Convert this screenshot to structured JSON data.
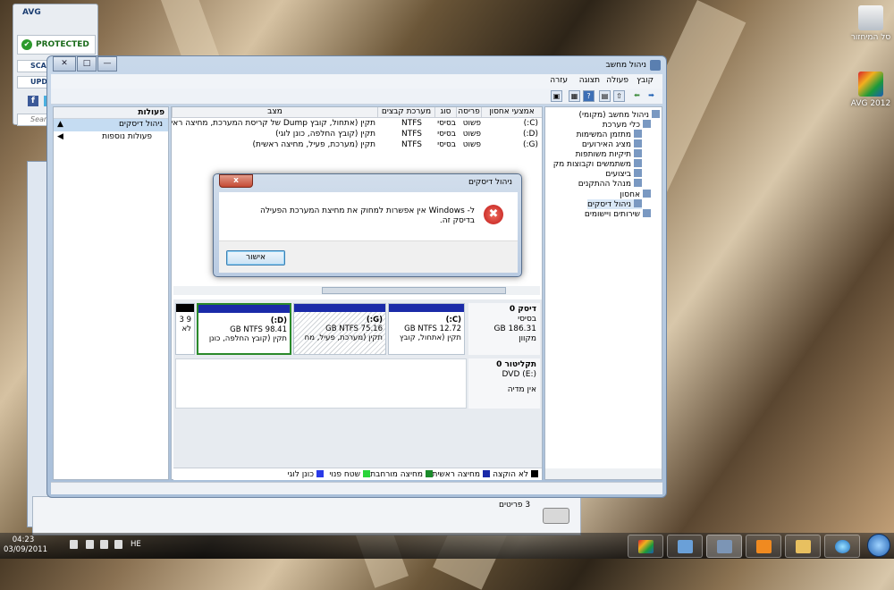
{
  "desktop": {
    "icons": [
      {
        "label": "סל המיחזור",
        "icon": "recycle-bin-icon"
      },
      {
        "label": "AVG 2012",
        "icon": "avg-icon"
      }
    ]
  },
  "avg_widget": {
    "logo": "AVG",
    "status": "PROTECTED",
    "scan_label": "SCA",
    "update_label": "UPDA",
    "facebook": "f",
    "search_placeholder": "Search"
  },
  "window": {
    "title": "ניהול מחשב",
    "buttons": {
      "close": "✕",
      "maximize": "□",
      "minimize": "—"
    },
    "menu": [
      "קובץ",
      "פעולה",
      "תצוגה",
      "עזרה"
    ],
    "toolbar_icons": [
      "back-icon",
      "forward-icon",
      "up-icon",
      "show-hide-tree-icon",
      "help-icon",
      "properties-icon",
      "export-icon"
    ]
  },
  "tree": {
    "items": [
      {
        "label": "ניהול מחשב (מקומי)",
        "level": 0
      },
      {
        "label": "כלי מערכת",
        "level": 1
      },
      {
        "label": "מתזמן המשימות",
        "level": 2
      },
      {
        "label": "מציג האירועים",
        "level": 2
      },
      {
        "label": "תיקיות משותפות",
        "level": 2
      },
      {
        "label": "משתמשים וקבוצות מק",
        "level": 2
      },
      {
        "label": "ביצועים",
        "level": 2
      },
      {
        "label": "מנהל ההתקנים",
        "level": 2
      },
      {
        "label": "אחסון",
        "level": 1
      },
      {
        "label": "ניהול דיסקים",
        "level": 2
      },
      {
        "label": "שירותים ויישומים",
        "level": 1
      }
    ]
  },
  "volumes": {
    "headers": [
      "אמצעי אחסון",
      "פריסה",
      "סוג",
      "מערכת קבצים",
      "מצב"
    ],
    "rows": [
      {
        "volume": "(C:)",
        "layout": "פשוט",
        "type": "בסיסי",
        "fs": "NTFS",
        "status": "תקין (אתחול, קובץ Dump של קריסת המערכת, מחיצה ראי"
      },
      {
        "volume": "(D:)",
        "layout": "פשוט",
        "type": "בסיסי",
        "fs": "NTFS",
        "status": "תקין (קובץ החלפה, כונן לוגי)"
      },
      {
        "volume": "(G:)",
        "layout": "פשוט",
        "type": "בסיסי",
        "fs": "NTFS",
        "status": "תקין (מערכת, פעיל, מחיצה ראשית)"
      }
    ]
  },
  "disks": {
    "disk0": {
      "name": "דיסק 0",
      "type": "בסיסי",
      "size": "186.31 GB",
      "state": "מקוון"
    },
    "partitions": [
      {
        "name": "(C:)",
        "size": "12.72 GB NTFS",
        "status": "תקין (אתחול, קובץ",
        "color": "#1a2aa8"
      },
      {
        "name": "(G:)",
        "size": "75.16 GB NTFS",
        "status": "תקין (מערכת, פעיל, מח",
        "color": "#1a2aa8"
      },
      {
        "name": "(D:)",
        "size": "98.41 GB NTFS",
        "status": "תקין (קובץ החלפה, כונן",
        "color": "#1a2aa8"
      },
      {
        "name": "",
        "size": "9 3",
        "status": "לא",
        "color": "#000000"
      }
    ],
    "cdrom0": {
      "name": "תקליטור 0",
      "type": "DVD (E:)",
      "state": "אין מדיה"
    }
  },
  "legend": [
    {
      "label": "לא הוקצה",
      "color": "#000000"
    },
    {
      "label": "מחיצה ראשית",
      "color": "#1a2aa8"
    },
    {
      "label": "מחיצה מורחבת",
      "color": "#1a8a2a"
    },
    {
      "label": "שטח פנוי",
      "color": "#2ad43a"
    },
    {
      "label": "כונן לוגי",
      "color": "#2a3ae8"
    }
  ],
  "actions": {
    "header": "פעולות",
    "selected": "ניהול דיסקים",
    "more": "פעולות נוספות"
  },
  "dialog": {
    "title": "ניהול דיסקים",
    "close": "x",
    "message": "ל- Windows אין אפשרות למחוק את מחיצת המערכת הפעילה בדיסק זה.",
    "ok": "אישור"
  },
  "explorer_status": {
    "items": "3 פריטים"
  },
  "taskbar": {
    "time": "04:23",
    "date": "03/09/2011",
    "language": "HE",
    "pinned": [
      "start-orb-icon",
      "internet-explorer-icon",
      "windows-explorer-icon",
      "media-player-icon",
      "computer-management-icon",
      "network-icon",
      "avg-icon"
    ]
  }
}
